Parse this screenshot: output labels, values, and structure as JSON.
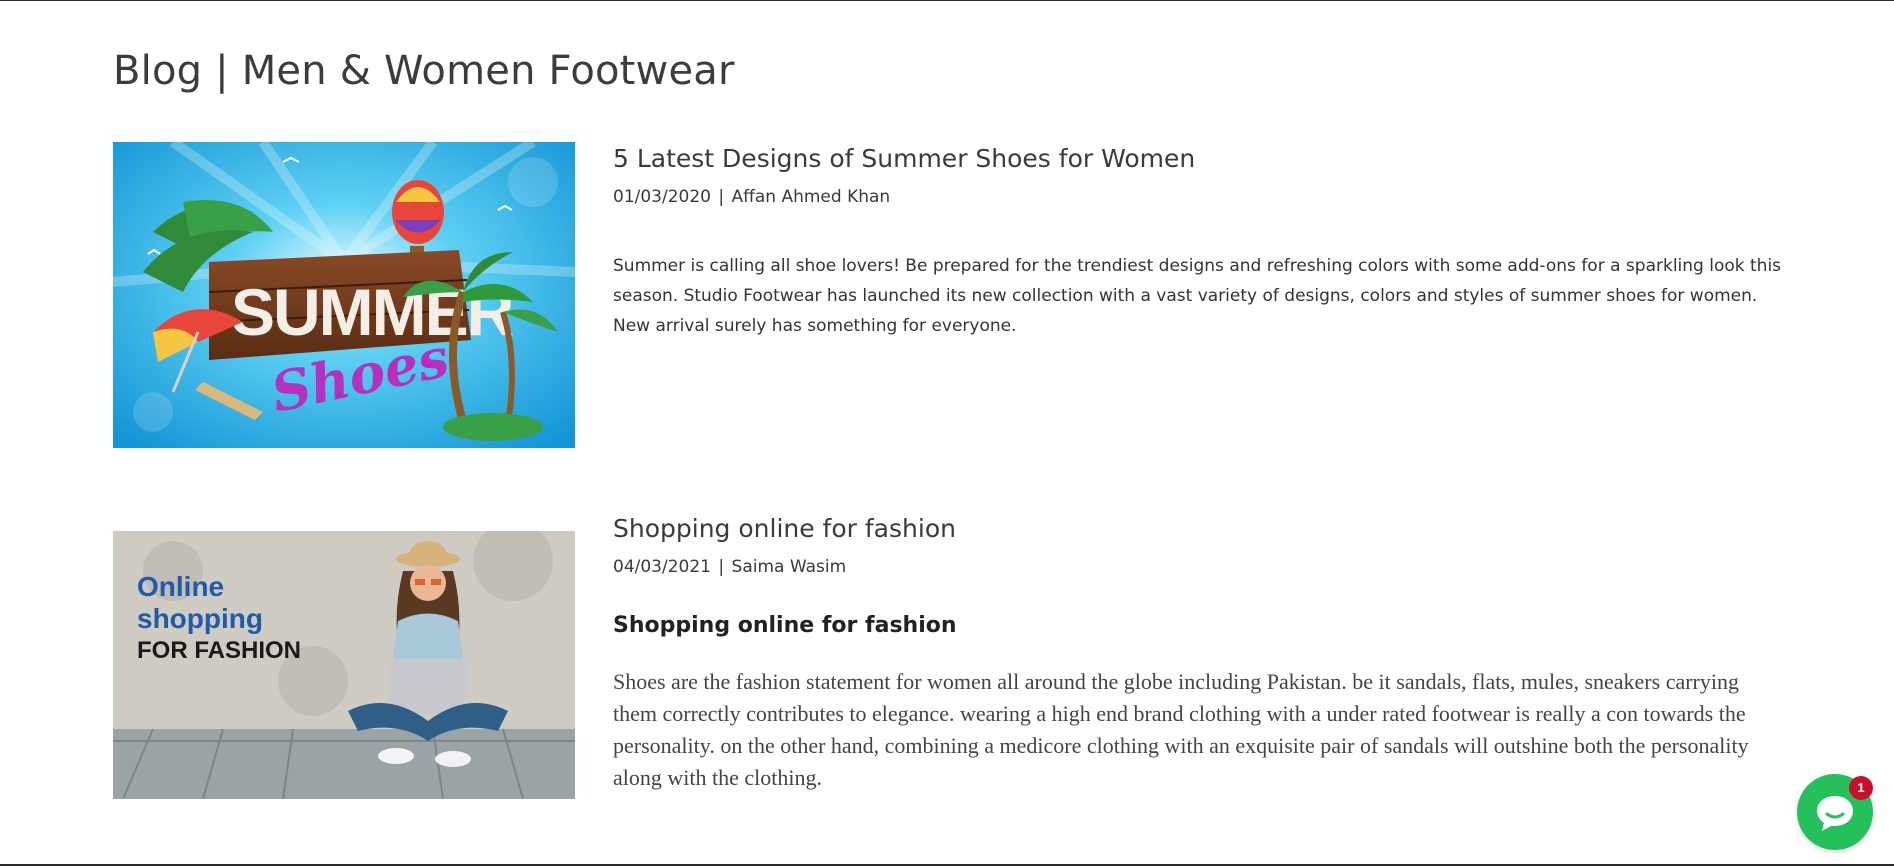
{
  "page": {
    "title": "Blog | Men & Women Footwear"
  },
  "posts": [
    {
      "title": "5 Latest Designs of Summer Shoes for Women",
      "date": "01/03/2020",
      "separator": "|",
      "author": "Affan Ahmed Khan",
      "excerpt": "Summer is calling all shoe lovers! Be prepared for the trendiest designs and refreshing colors with some add-ons for a sparkling look this season. Studio Footwear has launched its new collection with a vast variety of designs, colors and styles of summer shoes for women. New arrival surely has something for everyone.",
      "image": {
        "text_main": "SUMMER",
        "text_script": "Shoes"
      }
    },
    {
      "title": "Shopping online for fashion",
      "date": "04/03/2021",
      "separator": "|",
      "author": "Saima Wasim",
      "subheading": "Shopping online for fashion",
      "excerpt": "Shoes are the fashion statement for women all around the globe including Pakistan. be it sandals, flats, mules, sneakers carrying them correctly contributes to elegance. wearing a high end brand clothing with a under rated footwear is really a con towards the personality. on the other hand, combining a medicore clothing with an exquisite pair of sandals will outshine both the personality along with the clothing.",
      "image": {
        "line1": "Online",
        "line2": "shopping",
        "line3": "FOR FASHION"
      }
    }
  ],
  "chat": {
    "icon": "chat-bubble-icon",
    "badge_count": "1",
    "color": "#25c05c",
    "badge_color": "#c8102e"
  }
}
